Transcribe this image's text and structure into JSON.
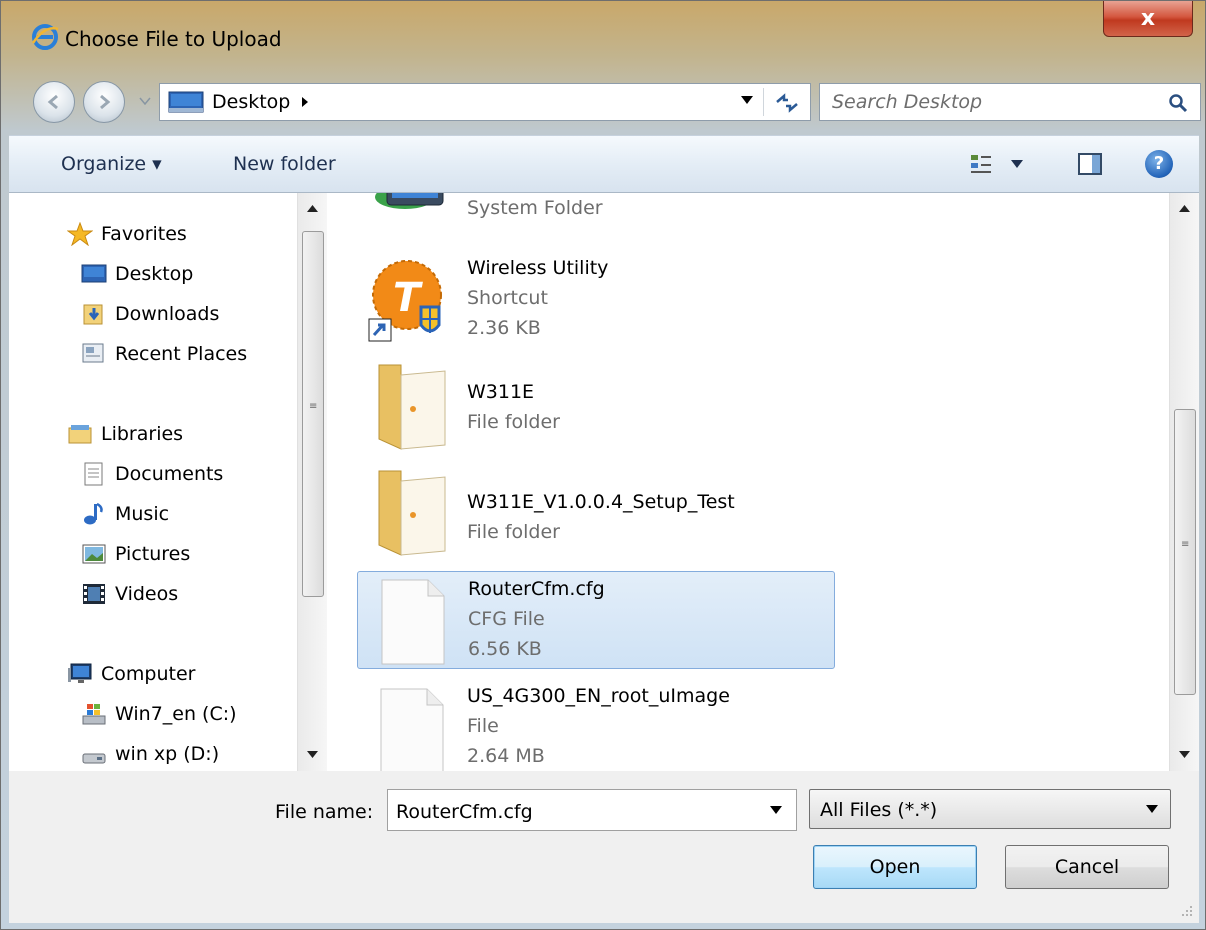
{
  "window": {
    "title": "Choose File to Upload",
    "close_label": "x"
  },
  "address": {
    "location": "Desktop",
    "search_placeholder": "Search Desktop"
  },
  "toolbar": {
    "organize_label": "Organize ▾",
    "new_folder_label": "New folder",
    "help_label": "?"
  },
  "navigation": {
    "favorites": "Favorites",
    "desktop": "Desktop",
    "downloads": "Downloads",
    "recent_places": "Recent Places",
    "libraries": "Libraries",
    "documents": "Documents",
    "music": "Music",
    "pictures": "Pictures",
    "videos": "Videos",
    "computer": "Computer",
    "drive_c": "Win7_en (C:)",
    "drive_d": "win xp (D:)"
  },
  "files": [
    {
      "name": "",
      "type": "System Folder",
      "size": "",
      "icon": "monitor-icon"
    },
    {
      "name": "Wireless Utility",
      "type": "Shortcut",
      "size": "2.36 KB",
      "icon": "shortcut-app-icon"
    },
    {
      "name": "W311E",
      "type": "File folder",
      "size": "",
      "icon": "folder-icon"
    },
    {
      "name": "W311E_V1.0.0.4_Setup_Test",
      "type": "File folder",
      "size": "",
      "icon": "folder-icon"
    },
    {
      "name": "RouterCfm.cfg",
      "type": "CFG File",
      "size": "6.56 KB",
      "icon": "file-icon",
      "selected": true
    },
    {
      "name": "US_4G300_EN_root_uImage",
      "type": "File",
      "size": "2.64 MB",
      "icon": "file-icon"
    }
  ],
  "bottom": {
    "file_name_label": "File name:",
    "file_name_value": "RouterCfm.cfg",
    "file_type_value": "All Files (*.*)",
    "open_label": "Open",
    "cancel_label": "Cancel"
  },
  "colors": {
    "selection": "#cfe2f5",
    "selection_border": "#84acdd",
    "meta_text": "#6d6d6d",
    "close_button": "#c0391f"
  }
}
